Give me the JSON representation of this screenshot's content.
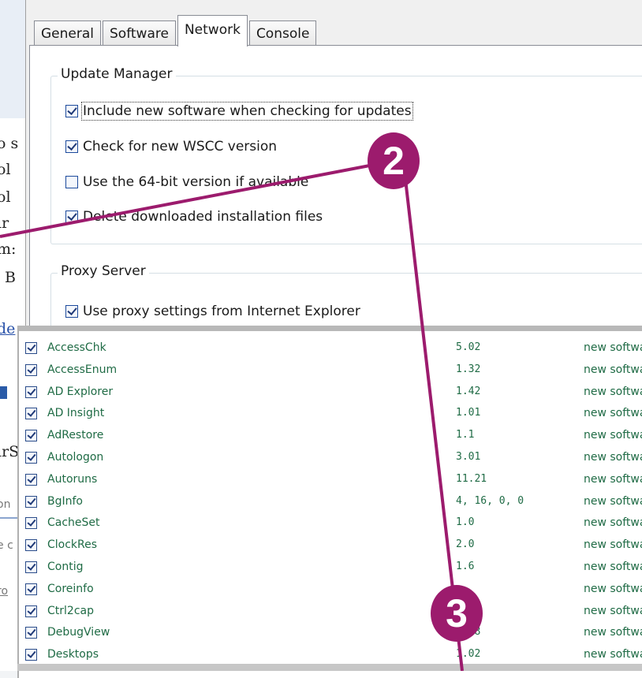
{
  "background_page": {
    "fragments": [
      "o s",
      "ol",
      "ol",
      "ır",
      "m:",
      "B",
      "de",
      "irS",
      "on",
      "e c",
      "ro"
    ]
  },
  "dialog": {
    "tabs": [
      {
        "label": "General",
        "active": false
      },
      {
        "label": "Software",
        "active": false
      },
      {
        "label": "Network",
        "active": true
      },
      {
        "label": "Console",
        "active": false
      }
    ],
    "update_manager": {
      "legend": "Update Manager",
      "options": [
        {
          "label": "Include new software when checking for updates",
          "checked": true
        },
        {
          "label": "Check for new WSCC version",
          "checked": true
        },
        {
          "label": "Use the 64-bit version if available",
          "checked": false
        },
        {
          "label": "Delete downloaded installation files",
          "checked": true
        }
      ]
    },
    "proxy_server": {
      "legend": "Proxy Server",
      "options": [
        {
          "label": "Use proxy settings from Internet Explorer",
          "checked": true
        }
      ]
    }
  },
  "software_list": {
    "rows": [
      {
        "name": "AccessChk",
        "version": "5.02",
        "status": "new softwa"
      },
      {
        "name": "AccessEnum",
        "version": "1.32",
        "status": "new softwa"
      },
      {
        "name": "AD Explorer",
        "version": "1.42",
        "status": "new softwa"
      },
      {
        "name": "AD Insight",
        "version": "1.01",
        "status": "new softwa"
      },
      {
        "name": "AdRestore",
        "version": "1.1",
        "status": "new softwa"
      },
      {
        "name": "Autologon",
        "version": "3.01",
        "status": "new softwa"
      },
      {
        "name": "Autoruns",
        "version": "11.21",
        "status": "new softwa"
      },
      {
        "name": "BgInfo",
        "version": "4, 16, 0, 0",
        "status": "new softwa"
      },
      {
        "name": "CacheSet",
        "version": "1.0",
        "status": "new softwa"
      },
      {
        "name": "ClockRes",
        "version": "2.0",
        "status": "new softwa"
      },
      {
        "name": "Contig",
        "version": "1.6",
        "status": "new softwa"
      },
      {
        "name": "Coreinfo",
        "version": "",
        "status": "new softwa"
      },
      {
        "name": "Ctrl2cap",
        "version": "",
        "status": "new softwa"
      },
      {
        "name": "DebugView",
        "version": "4.78",
        "status": "new softwa"
      },
      {
        "name": "Desktops",
        "version": "1.02",
        "status": "new softwa"
      }
    ]
  },
  "annotations": {
    "markers": [
      "2",
      "3"
    ],
    "color": "#9c1b6d"
  }
}
